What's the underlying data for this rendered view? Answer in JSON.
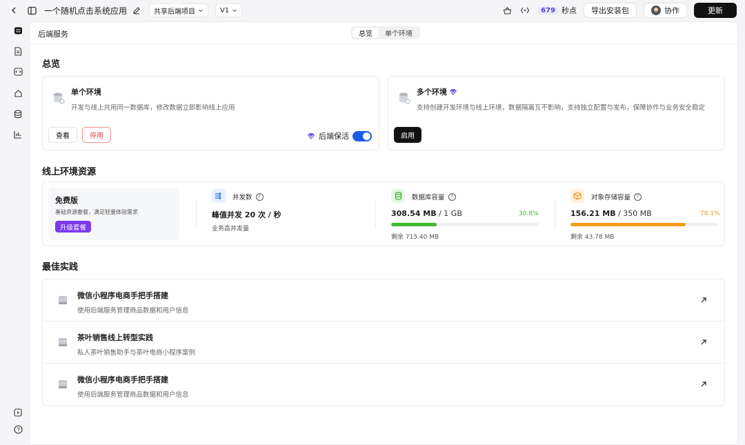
{
  "topbar": {
    "app_title": "一个随机点击系统应用",
    "project_dropdown": "共享后端项目",
    "version_dropdown": "V1",
    "points_value": "679",
    "points_unit": "秒点",
    "export_label": "导出安装包",
    "collab_label": "协作",
    "update_label": "更新"
  },
  "header": {
    "page_title": "后端服务",
    "tabs": [
      {
        "label": "总览",
        "active": true
      },
      {
        "label": "单个环境",
        "active": false
      }
    ]
  },
  "overview": {
    "title": "总览",
    "single_env": {
      "name": "单个环境",
      "desc": "开发与线上共用同一数据库，修改数据立即影响线上应用",
      "view_label": "查看",
      "stop_label": "停用",
      "keepalive_label": "后端保活",
      "keepalive_on": true
    },
    "multi_env": {
      "name": "多个环境",
      "desc": "支持创建开发环境与线上环境，数据隔离互不影响，支持独立配置与发布，保障协作与业务安全稳定",
      "enable_label": "启用"
    }
  },
  "resources": {
    "title": "线上环境资源",
    "plan": {
      "name": "免费版",
      "desc": "基础资源套餐，满足轻量体验需求",
      "upgrade_label": "升级套餐"
    },
    "concurrency": {
      "label": "并发数",
      "value": "峰值并发 20 次 / 秒",
      "sub": "业务高并发量"
    },
    "database": {
      "label": "数据库容量",
      "used": "308.54 MB",
      "total": " / 1 GB",
      "percent_text": "30.8%",
      "percent": 30.8,
      "remaining": "剩余 715.40 MB",
      "color": "#3dbb2c"
    },
    "storage": {
      "label": "对象存储容量",
      "used": "156.21 MB",
      "total": " / 350 MB",
      "percent_text": "78.1%",
      "percent": 78.1,
      "remaining": "剩余 43.78 MB",
      "color": "#f59a1b"
    }
  },
  "best_practices": {
    "title": "最佳实践",
    "items": [
      {
        "title": "微信小程序电商手把手搭建",
        "desc": "使用后端服务管理商品数据和用户信息"
      },
      {
        "title": "茶叶销售线上转型实践",
        "desc": "私人茶叶销售助手与茶叶电商小程序案例"
      },
      {
        "title": "微信小程序电商手把手搭建",
        "desc": "使用后端服务管理商品数据和用户信息"
      }
    ]
  }
}
